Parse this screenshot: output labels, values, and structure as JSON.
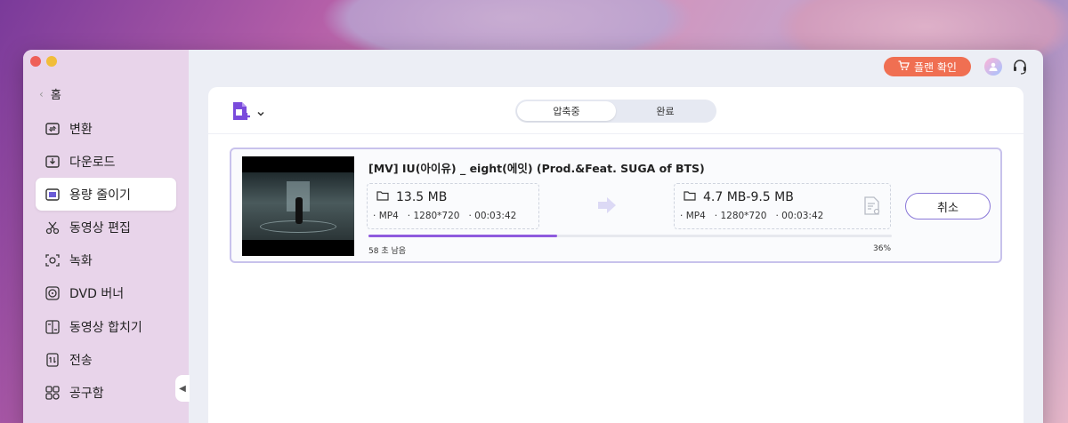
{
  "sidebar": {
    "back_label": "홈",
    "items": [
      {
        "label": "변환",
        "icon": "convert-icon"
      },
      {
        "label": "다운로드",
        "icon": "download-icon"
      },
      {
        "label": "용량 줄이기",
        "icon": "compress-icon",
        "active": true
      },
      {
        "label": "동영상 편집",
        "icon": "scissors-icon"
      },
      {
        "label": "녹화",
        "icon": "record-icon"
      },
      {
        "label": "DVD 버너",
        "icon": "disc-icon"
      },
      {
        "label": "동영상 합치기",
        "icon": "merge-icon"
      },
      {
        "label": "전송",
        "icon": "transfer-icon"
      },
      {
        "label": "공구함",
        "icon": "toolbox-icon"
      }
    ]
  },
  "topbar": {
    "plan_button_label": "플랜 확인",
    "accent_color": "#f06f52"
  },
  "tabs": [
    {
      "label": "압축중",
      "active": true
    },
    {
      "label": "완료",
      "active": false
    }
  ],
  "task": {
    "title": "[MV] IU(아이유) _ eight(에잇) (Prod.&Feat. SUGA of BTS)",
    "source": {
      "size": "13.5 MB",
      "format": "MP4",
      "resolution": "1280*720",
      "duration": "00:03:42"
    },
    "target": {
      "size": "4.7 MB-9.5 MB",
      "format": "MP4",
      "resolution": "1280*720",
      "duration": "00:03:42"
    },
    "progress_percent": 36,
    "progress_label": "36%",
    "remaining_text": "58 초 남음",
    "cancel_label": "취소",
    "progress_color": "#8f5bde"
  }
}
